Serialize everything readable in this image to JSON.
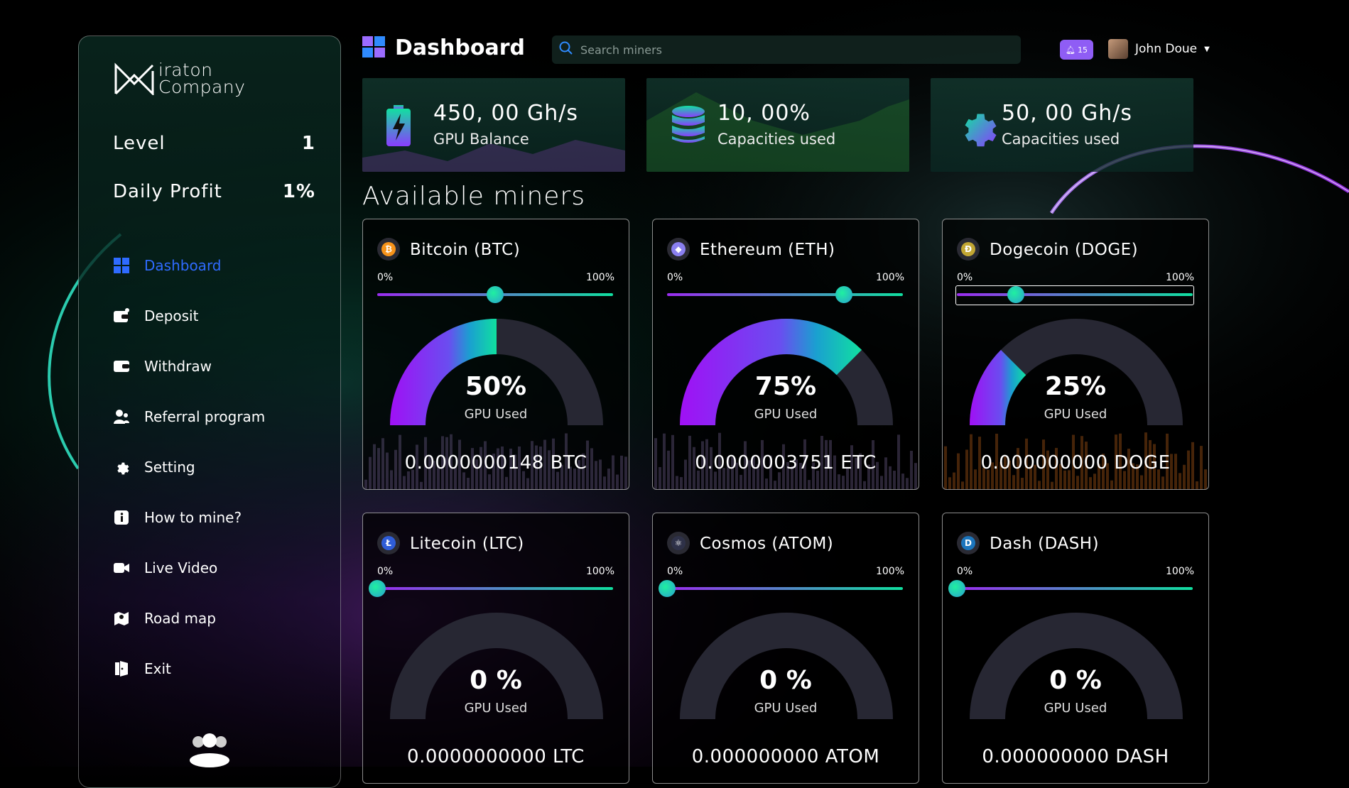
{
  "brand": {
    "line1": "iraton",
    "line2": "Company"
  },
  "sidebar": {
    "stats": [
      {
        "label": "Level",
        "value": "1"
      },
      {
        "label": "Daily Profit",
        "value": "1%"
      }
    ],
    "items": [
      {
        "label": "Dashboard",
        "icon": "dashboard-grid-icon",
        "active": true
      },
      {
        "label": "Deposit",
        "icon": "deposit-wallet-icon"
      },
      {
        "label": "Withdraw",
        "icon": "withdraw-wallet-icon"
      },
      {
        "label": "Referral program",
        "icon": "users-icon"
      },
      {
        "label": "Setting",
        "icon": "gear-icon"
      },
      {
        "label": "How to mine?",
        "icon": "info-icon"
      },
      {
        "label": "Live Video",
        "icon": "video-camera-icon"
      },
      {
        "label": "Road map",
        "icon": "map-pin-icon"
      },
      {
        "label": "Exit",
        "icon": "exit-door-icon"
      }
    ]
  },
  "header": {
    "title": "Dashboard",
    "search_placeholder": "Search miners",
    "notifications": "15",
    "user_name": "John Doue"
  },
  "stat_cards": [
    {
      "value": "450, 00 Gh/s",
      "label": "GPU Balance",
      "icon": "battery-bolt-icon"
    },
    {
      "value": "10, 00%",
      "label": "Capacities used",
      "icon": "database-icon"
    },
    {
      "value": "50, 00 Gh/s",
      "label": "Capacities used",
      "icon": "gear-icon"
    }
  ],
  "section_title": "Available miners",
  "miners": [
    {
      "name": "Bitcoin (BTC)",
      "percent_label": "50%",
      "used": 0.5,
      "slider": 0.5,
      "gpu_label": "GPU Used",
      "amount": "0.0000000148 BTC",
      "coin_color": "#f7931a",
      "coin_symbol": "₿",
      "min_label": "0%",
      "max_label": "100%"
    },
    {
      "name": "Ethereum (ETH)",
      "percent_label": "75%",
      "used": 0.75,
      "slider": 0.75,
      "gpu_label": "GPU Used",
      "amount": "0.0000003751 ETC",
      "coin_color": "#8a7ff0",
      "coin_symbol": "◆",
      "min_label": "0%",
      "max_label": "100%"
    },
    {
      "name": "Dogecoin (DOGE)",
      "percent_label": "25%",
      "used": 0.25,
      "slider": 0.25,
      "gpu_label": "GPU Used",
      "amount": "0.000000000 DOGE",
      "coin_color": "#c2a633",
      "coin_symbol": "Ð",
      "min_label": "0%",
      "max_label": "100%"
    },
    {
      "name": "Litecoin (LTC)",
      "percent_label": "0 %",
      "used": 0,
      "slider": 0,
      "gpu_label": "GPU Used",
      "amount": "0.0000000000 LTC",
      "coin_color": "#2f5dd8",
      "coin_symbol": "Ł",
      "min_label": "0%",
      "max_label": "100%"
    },
    {
      "name": "Cosmos (ATOM)",
      "percent_label": "0 %",
      "used": 0,
      "slider": 0,
      "gpu_label": "GPU Used",
      "amount": "0.000000000 ATOM",
      "coin_color": "#2e3148",
      "coin_symbol": "⚛",
      "min_label": "0%",
      "max_label": "100%"
    },
    {
      "name": "Dash (DASH)",
      "percent_label": "0 %",
      "used": 0,
      "slider": 0,
      "gpu_label": "GPU Used",
      "amount": "0.000000000 DASH",
      "coin_color": "#1c75bc",
      "coin_symbol": "D",
      "min_label": "0%",
      "max_label": "100%"
    }
  ],
  "colors": {
    "accent": "#2f6bff",
    "purple": "#9b2cf0",
    "green": "#10e0a0",
    "badge": "#8f5df5"
  }
}
